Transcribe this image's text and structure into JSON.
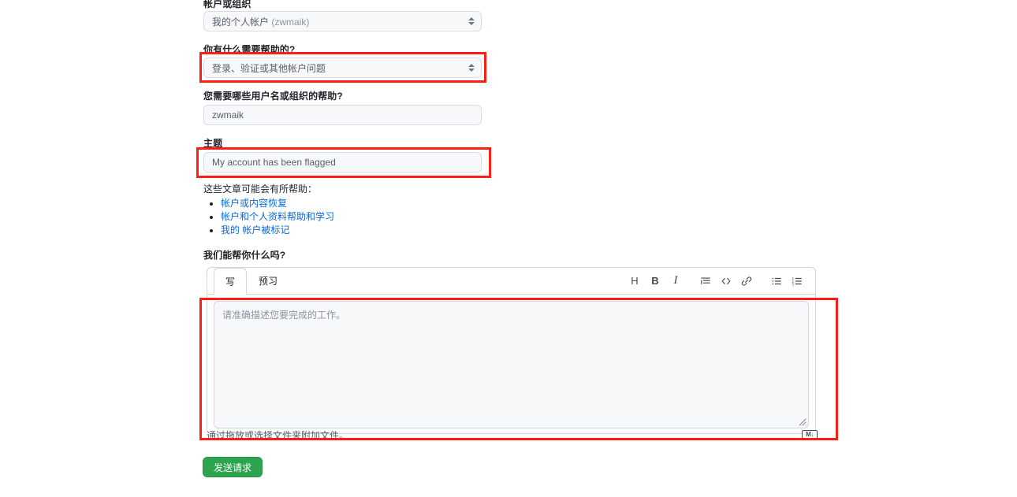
{
  "form": {
    "account_section": {
      "label": "帐户或组织",
      "value_main": "我的个人帐户",
      "value_suffix": " (zwmaik)"
    },
    "help_topic": {
      "label": "你有什么需要帮助的?",
      "value": "登录、验证或其他帐户问题"
    },
    "username_org": {
      "label": "您需要哪些用户名或组织的帮助?",
      "value": "zwmaik"
    },
    "subject": {
      "label": "主题",
      "value": "My account has been flagged"
    },
    "articles": {
      "intro": "这些文章可能会有所帮助：",
      "links": [
        "帐户或内容恢复",
        "帐户和个人资料帮助和学习",
        "我的 帐户被标记"
      ]
    },
    "description": {
      "label": "我们能帮你什么吗?",
      "tabs": [
        {
          "label": "写",
          "active": true
        },
        {
          "label": "预习",
          "active": false
        }
      ],
      "toolbar": [
        {
          "name": "heading-icon",
          "glyph": "H"
        },
        {
          "name": "bold-icon",
          "glyph": "B"
        },
        {
          "name": "italic-icon",
          "glyph": "I"
        },
        {
          "name": "quote-icon",
          "glyph": ""
        },
        {
          "name": "code-icon",
          "glyph": "<>"
        },
        {
          "name": "link-icon",
          "glyph": ""
        },
        {
          "name": "unordered-list-icon",
          "glyph": ""
        },
        {
          "name": "ordered-list-icon",
          "glyph": ""
        }
      ],
      "placeholder": "请准确描述您要完成的工作。",
      "attach_hint": "通过拖放或选择文件来附加文件。",
      "markdown_badge": "M↓"
    },
    "submit_label": "发送请求"
  },
  "colors": {
    "highlight": "#fd1e15",
    "submit_bg": "#2da44e",
    "link": "#0969da",
    "field_bg": "#f6f8fa",
    "border": "#d0d7de"
  }
}
